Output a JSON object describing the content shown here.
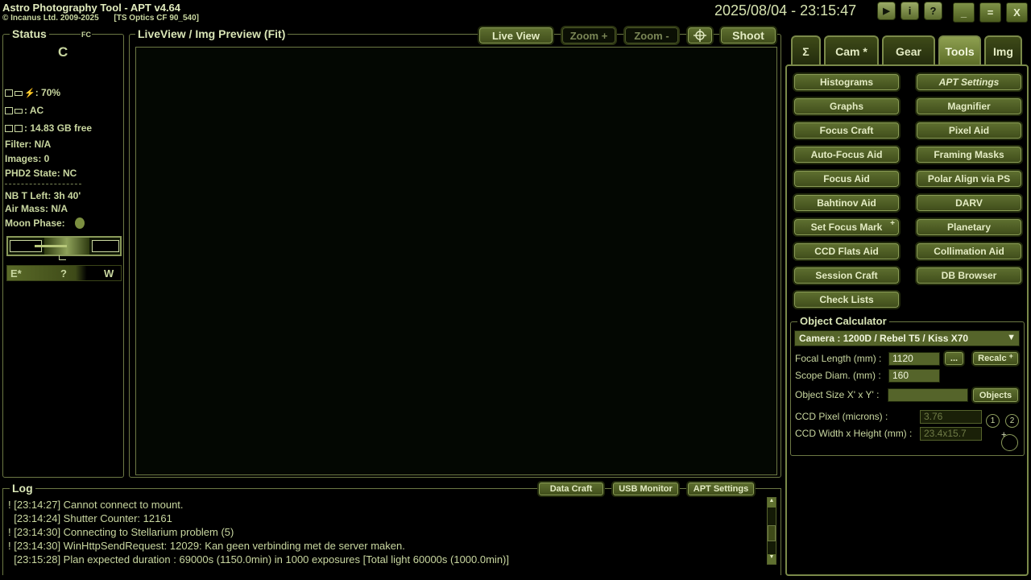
{
  "app": {
    "title": "Astro Photography Tool  -  APT v4.64",
    "copyright": "© Incanus Ltd. 2009-2025",
    "profile": "[TS Optics CF 90_540]",
    "datetime": "2025/08/04 - 23:15:47"
  },
  "titlebar_buttons": {
    "play": "▶",
    "info": "i",
    "help": "?",
    "minimize": "_",
    "maximize": "=",
    "close": "X"
  },
  "status": {
    "label": "Status",
    "fc": "FC",
    "connection_letter": "C",
    "battery": ": 70%",
    "power": ": AC",
    "disk": ": 14.83 GB free",
    "filter": "Filter: N/A",
    "images": "Images: 0",
    "phd2": "PHD2 State: NC",
    "nb_left": "NB T Left: 3h 40'",
    "air_mass": "Air Mass: N/A",
    "moon_phase": "Moon Phase:",
    "compass_e": "E*",
    "compass_q": "?",
    "compass_w": "W"
  },
  "preview": {
    "label": "LiveView / Img Preview (Fit)",
    "live_view": "Live View",
    "zoom_in": "Zoom +",
    "zoom_out": "Zoom -",
    "shoot": "Shoot"
  },
  "tabs": [
    "Σ",
    "Cam *",
    "Gear",
    "Tools",
    "Img"
  ],
  "tools": {
    "left": [
      "Histograms",
      "Graphs",
      "Focus Craft",
      "Auto-Focus Aid",
      "Focus Aid",
      "Bahtinov Aid",
      "Set Focus Mark",
      "CCD Flats Aid",
      "Session Craft",
      "Check Lists"
    ],
    "right": [
      "APT Settings",
      "Magnifier",
      "Pixel Aid",
      "Framing Masks",
      "Polar Align via PS",
      "DARV",
      "Planetary",
      "Collimation Aid",
      "DB Browser"
    ],
    "plus_mark": "+"
  },
  "object_calculator": {
    "label": "Object Calculator",
    "camera": "Camera : 1200D / Rebel T5 / Kiss X70",
    "focal_length_label": "Focal Length (mm) :",
    "focal_length": "1120",
    "more_button": "...",
    "recalc_button": "Recalc",
    "scope_diam_label": "Scope Diam. (mm) :",
    "scope_diam": "160",
    "object_size_label": "Object Size X' x Y' :",
    "object_size": "",
    "objects_button": "Objects",
    "ccd_pixel_label": "CCD Pixel (microns) :",
    "ccd_pixel": "3.76",
    "ccd_size_label": "CCD Width x Height (mm) :",
    "ccd_size": "23.4x15.7",
    "preset_1": "1",
    "preset_2": "2"
  },
  "log": {
    "label": "Log",
    "buttons": [
      "Data Craft",
      "USB Monitor",
      "APT Settings"
    ],
    "lines": [
      "! [23:14:27] Cannot connect to mount.",
      "  [23:14:24] Shutter Counter: 12161",
      "! [23:14:30] Connecting to Stellarium problem (5)",
      "! [23:14:30] WinHttpSendRequest: 12029: Kan geen verbinding met de server maken.",
      "  [23:15:28] Plan expected duration : 69000s (1150.0min) in 1000 exposures [Total light 60000s (1000.0min)]"
    ]
  },
  "colors": {
    "accent": "#5f7030",
    "text": "#c9d7a0",
    "background": "#000000",
    "frame": "#6c7844"
  }
}
